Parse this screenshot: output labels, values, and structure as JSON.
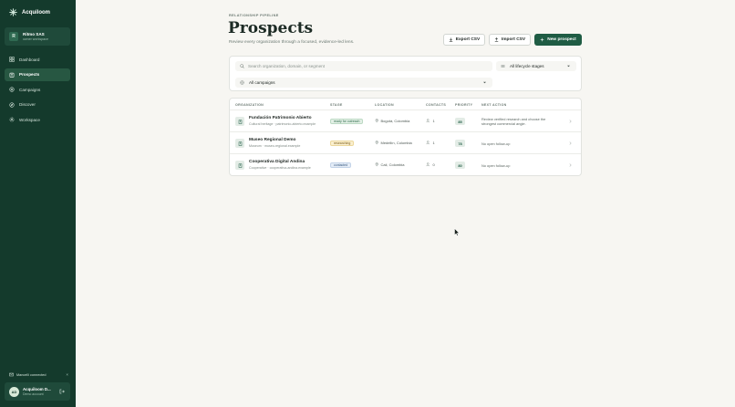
{
  "sidebar": {
    "brand": "Acquiloom",
    "workspace": {
      "initial": "R",
      "name": "Ritmo SAS",
      "role": "owner workspace"
    },
    "nav": [
      {
        "label": "Dashboard",
        "icon": "dashboard-icon",
        "active": false
      },
      {
        "label": "Prospects",
        "icon": "prospects-icon",
        "active": true
      },
      {
        "label": "Campaigns",
        "icon": "campaigns-icon",
        "active": false
      },
      {
        "label": "Discover",
        "icon": "discover-icon",
        "active": false
      },
      {
        "label": "Workspace",
        "icon": "gear-icon",
        "active": false
      }
    ],
    "connection": {
      "label": "Mancelli connected",
      "dismiss": "×"
    },
    "user": {
      "initials": "AD",
      "name": "Acquiloom D...",
      "role": "Demo account"
    }
  },
  "header": {
    "eyebrow": "RELATIONSHIP PIPELINE",
    "title": "Prospects",
    "subtitle": "Review every organization through a focused, evidence-led lens.",
    "export_label": "Export CSV",
    "import_label": "Import CSV",
    "new_label": "New prospect"
  },
  "filters": {
    "search_placeholder": "Search organization, domain, or segment",
    "stage_value": "All lifecycle stages",
    "campaign_value": "All campaigns"
  },
  "table": {
    "columns": [
      "ORGANIZATION",
      "STAGE",
      "LOCATION",
      "CONTACTS",
      "PRIORITY",
      "NEXT ACTION"
    ],
    "rows": [
      {
        "name": "Fundación Patrimonio Abierto",
        "meta": "Cultural heritage · patrimonio-abierto.example",
        "stage": "ready for outreach",
        "stage_bg": "#e3f0e6",
        "stage_fg": "#2c6a4a",
        "stage_border": "#bcd9c4",
        "location": "Bogotá, Colombia",
        "contacts": "1",
        "priority": "85",
        "next_action": [
          "Review verified research and choose the",
          "strongest commercial angle."
        ]
      },
      {
        "name": "Museo Regional Demo",
        "meta": "Museum · museo-regional.example",
        "stage": "researching",
        "stage_bg": "#faefcf",
        "stage_fg": "#7a5a12",
        "stage_border": "#ecd79b",
        "location": "Medellín, Colombia",
        "contacts": "1",
        "priority": "78",
        "next_action": [
          "No open follow-up"
        ]
      },
      {
        "name": "Cooperativa Digital Andina",
        "meta": "Cooperative · cooperativa-andina.example",
        "stage": "contacted",
        "stage_bg": "#e4ecf6",
        "stage_fg": "#35577f",
        "stage_border": "#c3d3e8",
        "location": "Cali, Colombia",
        "contacts": "0",
        "priority": "80",
        "next_action": [
          "No open follow-up"
        ]
      }
    ]
  }
}
